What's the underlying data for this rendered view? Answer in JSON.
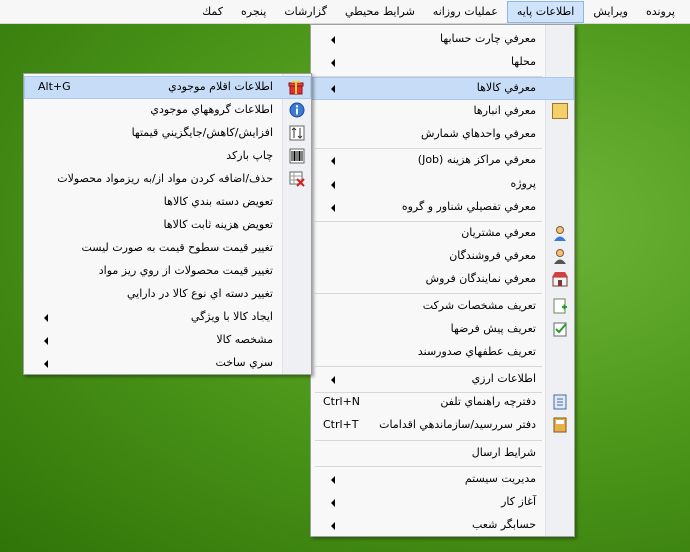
{
  "menubar": {
    "items": [
      {
        "label": "پرونده"
      },
      {
        "label": "ويرايش"
      },
      {
        "label": "اطلاعات پايه"
      },
      {
        "label": "عمليات روزانه"
      },
      {
        "label": "شرايط محيطي"
      },
      {
        "label": "گزارشات"
      },
      {
        "label": "پنجره"
      },
      {
        "label": "كمك"
      }
    ]
  },
  "main_menu": {
    "items": [
      {
        "label": "معرفي چارت حسابها"
      },
      {
        "label": "محلها"
      },
      {
        "label": "معرفي كالاها"
      },
      {
        "label": "معرفي انبارها"
      },
      {
        "label": "معرفي  واحدهاي شمارش"
      },
      {
        "label": "معرفي مراكز هزينه (Job)"
      },
      {
        "label": "پروژه"
      },
      {
        "label": "معرفي تفصيلي شناور و گروه"
      },
      {
        "label": "معرفي مشتريان"
      },
      {
        "label": "معرفي فروشندگان"
      },
      {
        "label": "معرفي نمايندگان فروش"
      },
      {
        "label": "تعريف مشخصات شركت"
      },
      {
        "label": "تعريف پيش فرضها"
      },
      {
        "label": "تعريف عطفهاي صدورسند"
      },
      {
        "label": "اطلاعات ارزي"
      },
      {
        "label": "دفترچه راهنماي تلفن",
        "shortcut": "Ctrl+N"
      },
      {
        "label": "دفتر سررسيد/سازماندهي اقدامات",
        "shortcut": "Ctrl+T"
      },
      {
        "label": "شرايط ارسال"
      },
      {
        "label": "مديريت سيستم"
      },
      {
        "label": "آغاز كار"
      },
      {
        "label": "حسابگر شعب"
      }
    ]
  },
  "sub_menu": {
    "items": [
      {
        "label": "اطلاعات اقلام موجودي",
        "shortcut": "Alt+G"
      },
      {
        "label": "اطلاعات گروههاي موجودي"
      },
      {
        "label": "افزايش/كاهش/جايگزيني قيمتها"
      },
      {
        "label": "چاپ باركد"
      },
      {
        "label": "حذف/اضافه كردن مواد از/به ريزمواد محصولات"
      },
      {
        "label": "تعويض دسته بندي كالاها"
      },
      {
        "label": "تعويض هزينه ثابت كالاها"
      },
      {
        "label": "تغيير قيمت سطوح قيمت به صورت ليست"
      },
      {
        "label": "تغيير قيمت محصولات از روي ريز مواد"
      },
      {
        "label": "تغيير دسته اي نوع كالا در دارايي"
      },
      {
        "label": "ايجاد كالا با ويژگي"
      },
      {
        "label": "مشخصه كالا"
      },
      {
        "label": "سري ساخت"
      }
    ]
  }
}
